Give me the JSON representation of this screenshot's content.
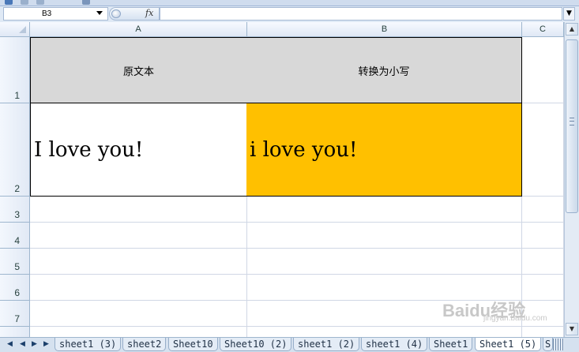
{
  "formula_bar": {
    "name_box": "B3",
    "fx_label": "fx",
    "formula": ""
  },
  "columns": [
    "A",
    "B",
    "C"
  ],
  "rows": [
    "1",
    "2",
    "3",
    "4",
    "5",
    "6",
    "7"
  ],
  "cells": {
    "A1": "原文本",
    "B1": "转换为小写",
    "A2": "I love you!",
    "B2": "i love you!"
  },
  "sheet_tabs": [
    "sheet1 (3)",
    "sheet2",
    "Sheet10",
    "Sheet10 (2)",
    "sheet1 (2)",
    "sheet1 (4)",
    "Sheet1",
    "Sheet1 (5)",
    "S"
  ],
  "active_tab_index": 7,
  "watermark": {
    "text": "Baidu经验",
    "sub": "jingyan.baidu.com"
  },
  "colors": {
    "header_fill": "#d8d8d8",
    "highlight_fill": "#ffc000",
    "grid_line": "#d0d7e5"
  },
  "icons": [
    "first-sheet-icon",
    "prev-sheet-icon",
    "next-sheet-icon",
    "last-sheet-icon",
    "fx-icon",
    "scroll-up-icon",
    "scroll-down-icon",
    "expand-formula-icon"
  ]
}
